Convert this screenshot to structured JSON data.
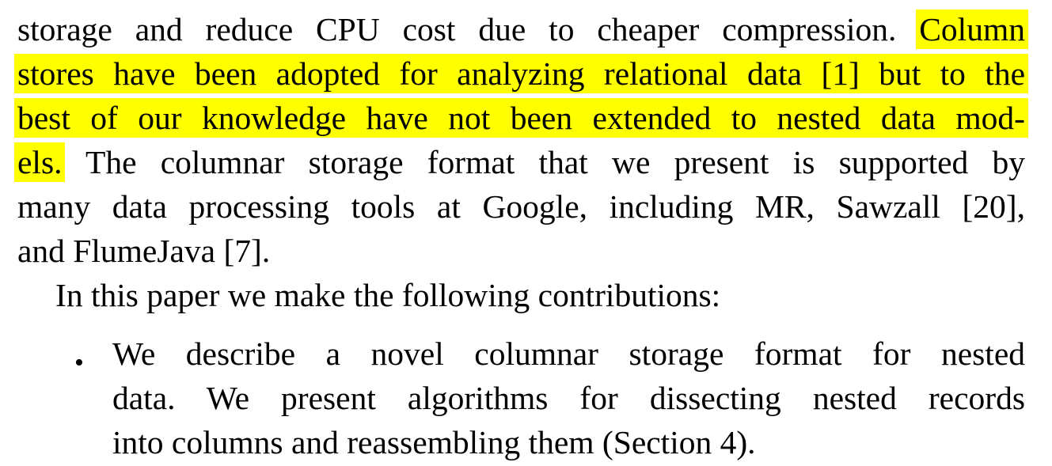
{
  "paragraph_1": {
    "line_1_plain": "storage and reduce CPU cost due to cheaper compression.",
    "line_1_highlight": "Column",
    "line_2_highlight": "stores have been adopted for analyzing relational data [1] but to the",
    "line_3_highlight": "best of our knowledge have not been extended to nested data mod-",
    "line_4_highlight": "els.",
    "line_4_plain": "The columnar storage format that we present is supported by",
    "line_5": "many data processing tools at Google, including MR, Sawzall [20],",
    "line_6": "and FlumeJava [7]."
  },
  "paragraph_2": {
    "line_1": "In this paper we make the following contributions:"
  },
  "bullet_list": {
    "bullet_symbol": "•",
    "item_1": {
      "line_1": "We describe a novel columnar storage format for nested",
      "line_2": "data. We present algorithms for dissecting nested records",
      "line_3": "into columns and reassembling them (Section 4)."
    }
  },
  "colors": {
    "highlight": "#ffff00",
    "text": "#000000"
  }
}
